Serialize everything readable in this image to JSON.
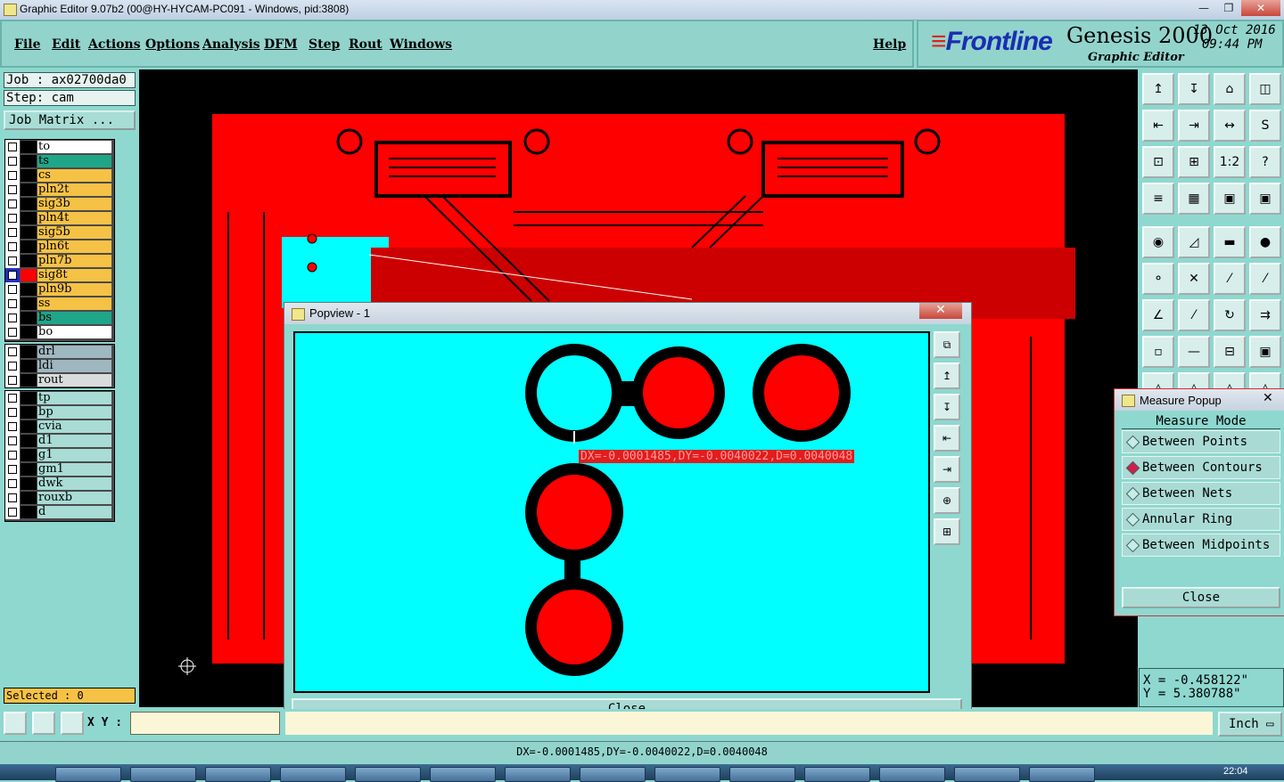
{
  "window": {
    "title": "Graphic Editor 9.07b2 (00@HY-HYCAM-PC091 - Windows, pid:3808)"
  },
  "menu": [
    "File",
    "Edit",
    "Actions",
    "Options",
    "Analysis",
    "DFM",
    "Step",
    "Rout",
    "Windows"
  ],
  "help": "Help",
  "brand": {
    "logo": "Frontline",
    "product": "Genesis 2000",
    "subtitle": "Graphic Editor",
    "date": "13 Oct 2016",
    "time": "09:44 PM"
  },
  "job": {
    "job": "Job : ax02700da0",
    "step": "Step: cam",
    "matrix": "Job Matrix ..."
  },
  "layers": [
    {
      "name": "to",
      "bg": "#ffffff"
    },
    {
      "name": "ts",
      "bg": "#1fa688"
    },
    {
      "name": "cs",
      "bg": "#f6c245"
    },
    {
      "name": "pln2t",
      "bg": "#f6c245"
    },
    {
      "name": "sig3b",
      "bg": "#f6c245"
    },
    {
      "name": "pln4t",
      "bg": "#f6c245"
    },
    {
      "name": "sig5b",
      "bg": "#f6c245"
    },
    {
      "name": "pln6t",
      "bg": "#f6c245"
    },
    {
      "name": "pln7b",
      "bg": "#f6c245"
    },
    {
      "name": "sig8t",
      "bg": "#f6c245",
      "active": true
    },
    {
      "name": "pln9b",
      "bg": "#f6c245"
    },
    {
      "name": "ss",
      "bg": "#f6c245"
    },
    {
      "name": "bs",
      "bg": "#1fa688"
    },
    {
      "name": "bo",
      "bg": "#ffffff"
    }
  ],
  "drill_layers": [
    {
      "name": "drl",
      "bg": "#9fb7c0"
    },
    {
      "name": "ldi",
      "bg": "#9fb7c0"
    },
    {
      "name": "rout",
      "bg": "#d8dcdc"
    }
  ],
  "misc_layers": [
    {
      "name": "tp",
      "bg": "#a8dcd5"
    },
    {
      "name": "bp",
      "bg": "#a8dcd5"
    },
    {
      "name": "cvia",
      "bg": "#a8dcd5"
    },
    {
      "name": "d1",
      "bg": "#a8dcd5"
    },
    {
      "name": "g1",
      "bg": "#a8dcd5"
    },
    {
      "name": "gm1",
      "bg": "#a8dcd5"
    },
    {
      "name": "dwk",
      "bg": "#a8dcd5"
    },
    {
      "name": "rouxb",
      "bg": "#a8dcd5"
    },
    {
      "name": "d",
      "bg": "#a8dcd5"
    }
  ],
  "selected": "Selected : 0",
  "popview": {
    "title": "Popview - 1",
    "measurement": "DX=-0.0001485,DY=-0.0040022,D=0.0040048",
    "close": "Close"
  },
  "measure": {
    "title": "Measure Popup",
    "mode_label": "Measure Mode",
    "options": [
      {
        "label": "Between Points",
        "selected": false
      },
      {
        "label": "Between Contours",
        "selected": true
      },
      {
        "label": "Between Nets",
        "selected": false
      },
      {
        "label": "Annular Ring",
        "selected": false
      },
      {
        "label": "Between Midpoints",
        "selected": false
      }
    ],
    "close": "Close"
  },
  "coords": {
    "x": "X = -0.458122\"",
    "y": "Y = 5.380788\""
  },
  "bottom": {
    "xy_label": "X Y :",
    "xy_value": "",
    "units": "Inch"
  },
  "status": "DX=-0.0001485,DY=-0.0040022,D=0.0040048",
  "taskbar": {
    "time": "22:04"
  },
  "colors": {
    "board": "#ff0000",
    "popview_bg": "#00ffff",
    "panel": "#8ed8d0"
  },
  "toolbar_icons": [
    "1:2",
    "?"
  ]
}
